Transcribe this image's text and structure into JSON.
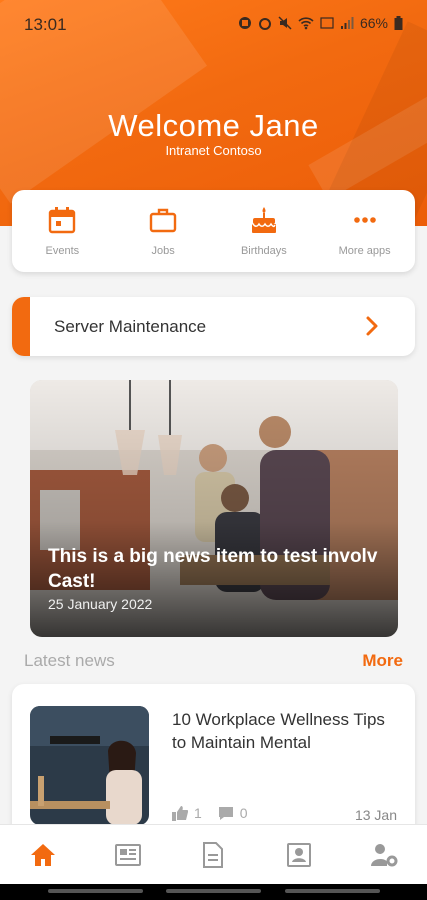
{
  "status_bar": {
    "time": "13:01",
    "battery": "66%"
  },
  "header": {
    "welcome": "Welcome Jane",
    "subtitle": "Intranet Contoso"
  },
  "apps": [
    {
      "label": "Events",
      "icon": "calendar-icon"
    },
    {
      "label": "Jobs",
      "icon": "briefcase-icon"
    },
    {
      "label": "Birthdays",
      "icon": "cake-icon"
    },
    {
      "label": "More apps",
      "icon": "more-dots-icon"
    }
  ],
  "banner": {
    "text": "Server Maintenance",
    "icon": "chevron-right-icon"
  },
  "hero": {
    "title": "This is a big news item to test involv Cast!",
    "date": "25 January 2022"
  },
  "latest": {
    "title": "Latest news",
    "more": "More"
  },
  "news": [
    {
      "title": "10 Workplace Wellness Tips to Maintain Mental",
      "likes": "1",
      "comments": "0",
      "date": "13 Jan"
    }
  ],
  "nav": [
    {
      "icon": "home-icon",
      "active": true
    },
    {
      "icon": "news-icon",
      "active": false
    },
    {
      "icon": "document-icon",
      "active": false
    },
    {
      "icon": "contact-card-icon",
      "active": false
    },
    {
      "icon": "user-settings-icon",
      "active": false
    }
  ],
  "colors": {
    "accent": "#f26a10",
    "inactive": "#999999"
  }
}
